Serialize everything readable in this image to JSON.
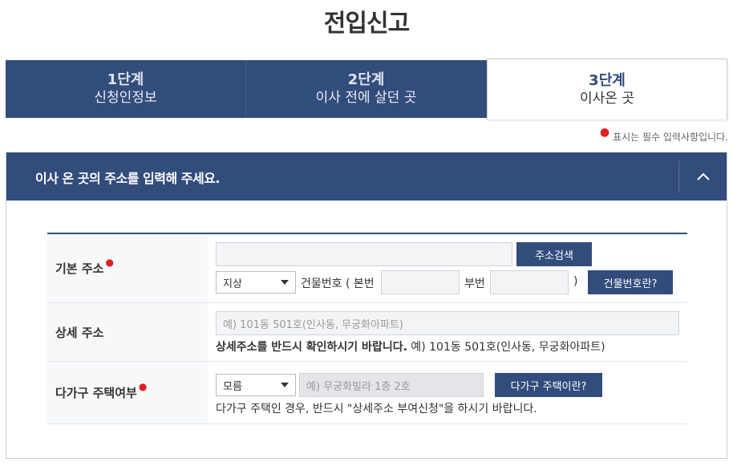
{
  "page": {
    "title": "전입신고"
  },
  "steps": [
    {
      "num": "1단계",
      "name": "신청인정보"
    },
    {
      "num": "2단계",
      "name": "이사 전에 살던 곳"
    },
    {
      "num": "3단계",
      "name": "이사온 곳"
    }
  ],
  "required_note": "표시는 필수 입력사항입니다.",
  "section": {
    "title": "이사 온 곳의 주소를 입력해 주세요."
  },
  "basic_address": {
    "label": "기본 주소",
    "address_value": "",
    "search_button": "주소검색",
    "type_select": "지상",
    "building_label": "건물번호 ( 본번",
    "main_number": "",
    "sub_label": "부번",
    "sub_number": "",
    "close_paren": ")",
    "building_help_button": "건물번호란?"
  },
  "detail_address": {
    "label": "상세 주소",
    "placeholder": "예) 101동 501호(인사동, 무궁화아파트)",
    "note_bold": "상세주소를 반드시 확인하시기 바랍니다.",
    "note_example": " 예) 101동 501호(인사동, 무궁화아파트)"
  },
  "multi_house": {
    "label": "다가구 주택여부",
    "select_value": "모름",
    "placeholder": "예) 무궁화빌라 1층 2호",
    "help_button": "다가구 주택이란?",
    "note": "다가구 주택인 경우, 반드시 \"상세주소 부여신청\"을 하시기 바랍니다."
  },
  "colors": {
    "primary": "#324c7c",
    "required": "#e02020",
    "label_bg": "#f7f8fa"
  }
}
